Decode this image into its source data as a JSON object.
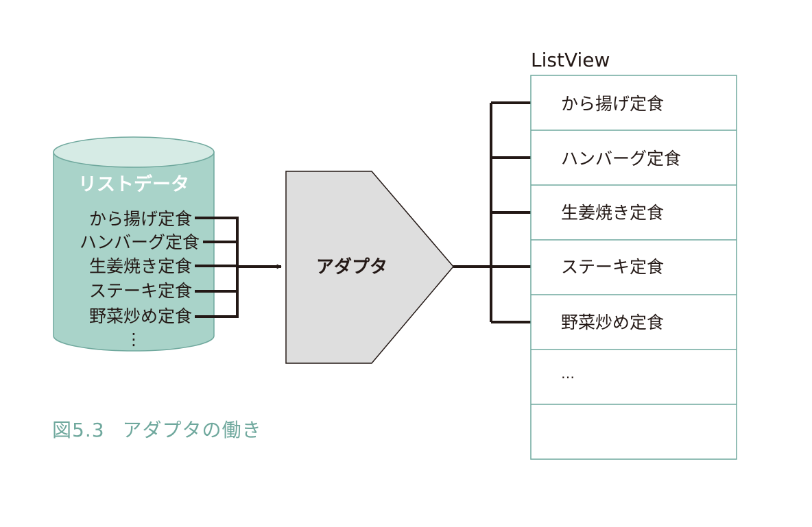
{
  "data_source": {
    "title": "リストデータ",
    "items": [
      "から揚げ定食",
      "ハンバーグ定食",
      "生姜焼き定食",
      "ステーキ定食",
      "野菜炒め定食"
    ],
    "more": "⋮",
    "fill_color": "#a9d3c9",
    "top_color": "#d6ebe5",
    "stroke_color": "#6fa89d"
  },
  "adapter": {
    "label": "アダプタ",
    "fill_color": "#dedede"
  },
  "list_view": {
    "title": "ListView",
    "items": [
      "から揚げ定食",
      "ハンバーグ定食",
      "生姜焼き定食",
      "ステーキ定食",
      "野菜炒め定食"
    ],
    "more": "…",
    "border_color": "#6fa89d"
  },
  "caption": {
    "number": "図5.3",
    "text": "アダプタの働き",
    "color": "#6fa89d"
  }
}
